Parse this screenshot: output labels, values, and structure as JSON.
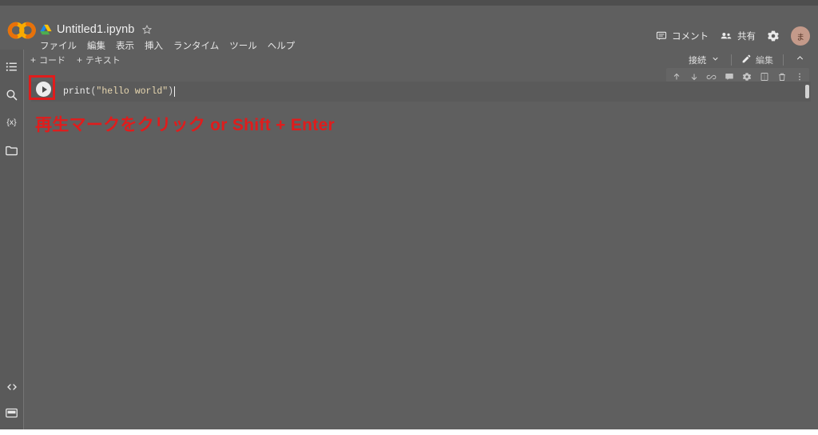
{
  "app": {
    "name": "Google Colaboratory",
    "logo_icon": "colab-co-logo",
    "accent_color": "#f9ab00",
    "background_color": "#5f5f5f",
    "annotation_color": "#e01c1c"
  },
  "header": {
    "drive_icon": "google-drive-icon",
    "doc_title": "Untitled1.ipynb",
    "star_icon": "star-outline-icon",
    "menu_items": [
      {
        "label": "ファイル",
        "name": "menu-file"
      },
      {
        "label": "編集",
        "name": "menu-edit"
      },
      {
        "label": "表示",
        "name": "menu-view"
      },
      {
        "label": "挿入",
        "name": "menu-insert"
      },
      {
        "label": "ランタイム",
        "name": "menu-runtime"
      },
      {
        "label": "ツール",
        "name": "menu-tools"
      },
      {
        "label": "ヘルプ",
        "name": "menu-help"
      }
    ],
    "comment_label": "コメント",
    "comment_icon": "comment-icon",
    "share_label": "共有",
    "share_icon": "people-share-icon",
    "settings_icon": "gear-icon",
    "avatar_initial": "ま"
  },
  "toolbar": {
    "add_code_label": "コード",
    "add_text_label": "テキスト",
    "plus_symbol": "+",
    "connect_label": "接続",
    "connect_caret_icon": "chevron-down-icon",
    "edit_label": "編集",
    "edit_icon": "pencil-icon",
    "collapse_icon": "chevron-up-icon"
  },
  "sidebar": {
    "top_items": [
      {
        "label": "目次",
        "icon": "table-of-contents-icon",
        "name": "sidebar-item-toc"
      },
      {
        "label": "検索",
        "icon": "search-icon",
        "name": "sidebar-item-search"
      },
      {
        "label": "変数",
        "icon": "variables-icon",
        "glyph": "{x}",
        "name": "sidebar-item-variables"
      },
      {
        "label": "ファイル",
        "icon": "folder-icon",
        "name": "sidebar-item-files"
      }
    ],
    "bottom_items": [
      {
        "label": "コードスニペット",
        "icon": "code-brackets-icon",
        "glyph": "< >",
        "name": "sidebar-item-snippets"
      },
      {
        "label": "ターミナル",
        "icon": "terminal-icon",
        "name": "sidebar-item-terminal"
      }
    ]
  },
  "notebook": {
    "cell": {
      "run_button_icon": "play-circle-icon",
      "run_button_highlighted": true,
      "highlight_color": "#e01c1c",
      "code_tokens": [
        {
          "text": "print",
          "type": "name"
        },
        {
          "text": "(",
          "type": "paren"
        },
        {
          "text": "\"hello world\"",
          "type": "string"
        },
        {
          "text": ")",
          "type": "paren"
        }
      ],
      "code_text": "print(\"hello world\")",
      "toolbar_icons": [
        {
          "icon": "arrow-up-icon",
          "name": "move-cell-up-button"
        },
        {
          "icon": "arrow-down-icon",
          "name": "move-cell-down-button"
        },
        {
          "icon": "link-icon",
          "name": "copy-cell-link-button"
        },
        {
          "icon": "comment-icon",
          "name": "add-comment-button"
        },
        {
          "icon": "gear-icon",
          "name": "cell-settings-button"
        },
        {
          "icon": "mirror-cell-icon",
          "name": "mirror-cell-button"
        },
        {
          "icon": "trash-icon",
          "name": "delete-cell-button"
        },
        {
          "icon": "more-vert-icon",
          "name": "more-options-button"
        }
      ]
    }
  },
  "annotation": {
    "text": "再生マークをクリック or Shift + Enter"
  }
}
